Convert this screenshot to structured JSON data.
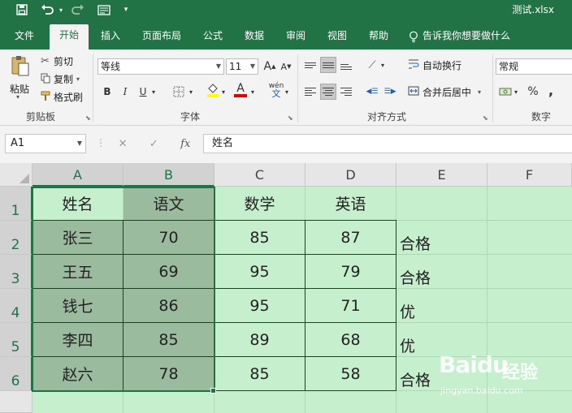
{
  "window": {
    "title": "测试.xlsx",
    "accent": "#217346"
  },
  "quick_access": {
    "save_icon": "save-icon",
    "undo_icon": "undo-icon",
    "redo_icon": "redo-icon",
    "form_icon": "form-icon",
    "customize": "▾"
  },
  "tabs": [
    {
      "label": "文件"
    },
    {
      "label": "开始"
    },
    {
      "label": "插入"
    },
    {
      "label": "页面布局"
    },
    {
      "label": "公式"
    },
    {
      "label": "数据"
    },
    {
      "label": "审阅"
    },
    {
      "label": "视图"
    },
    {
      "label": "帮助"
    },
    {
      "label": "告诉我你想要做什么"
    }
  ],
  "ribbon": {
    "clipboard": {
      "paste": "粘贴",
      "cut": "剪切",
      "copy": "复制",
      "format_painter": "格式刷",
      "group": "剪贴板"
    },
    "font": {
      "name": "等线",
      "size": "11",
      "bold": "B",
      "italic": "I",
      "underline": "U",
      "phonetic": "wén",
      "group": "字体",
      "grow": "A",
      "shrink": "A",
      "font_color": "A"
    },
    "alignment": {
      "wrap": "自动换行",
      "merge": "合并后居中",
      "group": "对齐方式"
    },
    "number": {
      "format": "常规",
      "percent": "%",
      "comma": ",",
      "group": "数字"
    }
  },
  "formula_bar": {
    "name_box": "A1",
    "cancel": "✕",
    "enter": "✓",
    "fx": "fx",
    "content": "姓名"
  },
  "columns": [
    "A",
    "B",
    "C",
    "D",
    "E",
    "F"
  ],
  "rows": [
    "1",
    "2",
    "3",
    "4",
    "5",
    "6"
  ],
  "table": {
    "headers": [
      "姓名",
      "语文",
      "数学",
      "英语"
    ],
    "rows": [
      [
        "张三",
        "70",
        "85",
        "87",
        "合格"
      ],
      [
        "王五",
        "69",
        "95",
        "79",
        "合格"
      ],
      [
        "钱七",
        "86",
        "95",
        "71",
        "优"
      ],
      [
        "李四",
        "85",
        "89",
        "68",
        "优"
      ],
      [
        "赵六",
        "78",
        "85",
        "58",
        "合格"
      ]
    ]
  },
  "watermark": {
    "logo": "Bai",
    "cn": "经验",
    "url": "jingyan.baidu.com"
  }
}
